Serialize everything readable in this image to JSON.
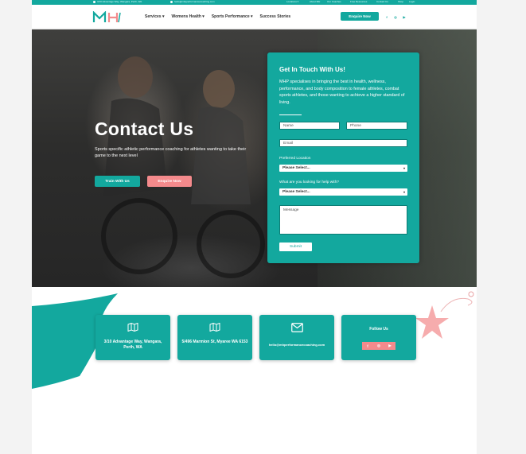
{
  "topbar": {
    "address": "3/10 Advantage Way, Wangara, Perth, WA",
    "email": "hello@mhpperformancecoaching.com",
    "links": [
      "Locations",
      "About MH",
      "Our Coaches",
      "Free Resources",
      "Contact Us",
      "Shop",
      "Login"
    ]
  },
  "header": {
    "logo_text": "MH",
    "nav": [
      "Services",
      "Womens Health",
      "Sports Performance",
      "Success Stories"
    ],
    "enquire_label": "Enquire Now",
    "socials": [
      "facebook-icon",
      "instagram-icon",
      "youtube-icon"
    ]
  },
  "hero": {
    "title": "Contact Us",
    "subtitle": "Sports specific athletic performance coaching for athletes wanting to take their game to the next level",
    "btn_train": "Train With Us",
    "btn_enquire": "Enquire Now"
  },
  "form": {
    "title": "Get In Touch With Us!",
    "text": "MHP specialises in bringing the best in health, wellness, performance, and body composition to female athletes, combat sports athletes, and those wanting to achieve a higher standard of living.",
    "name_placeholder": "Name",
    "phone_placeholder": "Phone",
    "email_placeholder": "Email",
    "location_label": "Preferred Location",
    "location_value": "Please Select...",
    "help_label": "What are you looking for help with?",
    "help_value": "Please Select...",
    "message_placeholder": "Message",
    "submit_label": "Submit"
  },
  "info": {
    "location1": "3/10 Advantage Way, Wangara, Perth, WA",
    "location2": "5/496 Marmion St, Myaree WA 6153",
    "email": "hello@mhperformancecoaching.com",
    "follow_title": "Follow Us"
  },
  "colors": {
    "teal": "#13a89e",
    "pink": "#f48a8c"
  }
}
